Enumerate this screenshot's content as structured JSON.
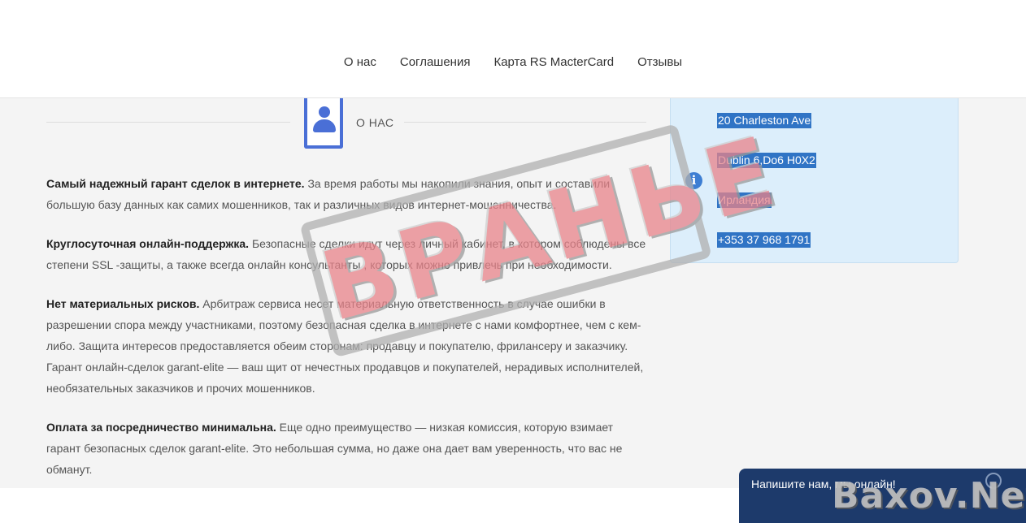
{
  "nav": {
    "items": [
      {
        "label": "О нас"
      },
      {
        "label": "Соглашения"
      },
      {
        "label": "Карта RS MacterCard"
      },
      {
        "label": "Отзывы"
      }
    ]
  },
  "about": {
    "title": "О НАС",
    "icon": "user-profile-icon"
  },
  "paragraphs": [
    {
      "heading": "Самый надежный гарант сделок в интернете.",
      "text": " За время работы мы накопили знания, опыт и составили большую базу данных как самих мошенников, так и различных видов интернет-мошенничества."
    },
    {
      "heading": "Круглосуточная онлайн-поддержка.",
      "text": " Безопасные сделки идут через личный кабинет, в котором соблюдены все степени SSL -защиты, а также всегда онлайн консультанты , которых можно привлечь при необходимости."
    },
    {
      "heading": "Нет материальных рисков.",
      "text": " Арбитраж сервиса несет материальную ответственность в случае ошибки в разрешении спора между участниками, поэтому безопасная сделка в интернете с нами комфортнее, чем с кем-либо. Защита интересов предоставляется обеим сторонам: продавцу и покупателю, фрилансеру и заказчику. Гарант онлайн-сделок garant-elite — ваш щит от нечестных продавцов и покупателей, нерадивых исполнителей, необязательных заказчиков и прочих мошенников."
    },
    {
      "heading": "Оплата за посредничество минимальна.",
      "text": " Еще одно преимущество — низкая комиссия, которую взимает гарант безопасных сделок garant-elite. Это небольшая сумма, но даже она дает вам уверенность, что вас не обманут."
    }
  ],
  "contact": {
    "address_line1": "20 Charleston Ave",
    "address_line2": "Dublin 6,Do6 H0X2",
    "country": "Ирландия",
    "phone": "+353 37 968 1791",
    "info_icon": "info-icon",
    "highlight_color": "#3074c5",
    "box_color": "#dceefb"
  },
  "stamp": {
    "text": "ВРАНЬЕ",
    "color": "#e8838a"
  },
  "chat": {
    "prompt": "Напишите нам, мы онлайн!"
  },
  "watermark": {
    "text": "Baxov.Net"
  },
  "colors": {
    "accent": "#4a6fd6",
    "chat_bar": "#1d3a6b"
  }
}
